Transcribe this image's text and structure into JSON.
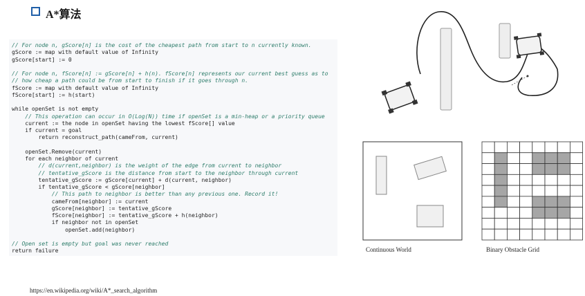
{
  "slide": {
    "title": "A*算法",
    "code_lines": [
      {
        "text": "// For node n, gScore[n] is the cost of the cheapest path from start to n currently known.",
        "type": "comment"
      },
      {
        "text": "gScore := map with default value of Infinity",
        "type": "code"
      },
      {
        "text": "gScore[start] := 0",
        "type": "code"
      },
      {
        "text": "",
        "type": "code"
      },
      {
        "text": "// For node n, fScore[n] := gScore[n] + h(n). fScore[n] represents our current best guess as to",
        "type": "comment"
      },
      {
        "text": "// how cheap a path could be from start to finish if it goes through n.",
        "type": "comment"
      },
      {
        "text": "fScore := map with default value of Infinity",
        "type": "code"
      },
      {
        "text": "fScore[start] := h(start)",
        "type": "code"
      },
      {
        "text": "",
        "type": "code"
      },
      {
        "text": "while openSet is not empty",
        "type": "code"
      },
      {
        "text": "    // This operation can occur in O(Log(N)) time if openSet is a min-heap or a priority queue",
        "type": "comment"
      },
      {
        "text": "    current := the node in openSet having the lowest fScore[] value",
        "type": "code"
      },
      {
        "text": "    if current = goal",
        "type": "code"
      },
      {
        "text": "        return reconstruct_path(cameFrom, current)",
        "type": "code"
      },
      {
        "text": "",
        "type": "code"
      },
      {
        "text": "    openSet.Remove(current)",
        "type": "code"
      },
      {
        "text": "    for each neighbor of current",
        "type": "code"
      },
      {
        "text": "        // d(current,neighbor) is the weight of the edge from current to neighbor",
        "type": "comment"
      },
      {
        "text": "        // tentative_gScore is the distance from start to the neighbor through current",
        "type": "comment"
      },
      {
        "text": "        tentative_gScore := gScore[current] + d(current, neighbor)",
        "type": "code"
      },
      {
        "text": "        if tentative_gScore < gScore[neighbor]",
        "type": "code"
      },
      {
        "text": "            // This path to neighbor is better than any previous one. Record it!",
        "type": "comment"
      },
      {
        "text": "            cameFrom[neighbor] := current",
        "type": "code"
      },
      {
        "text": "            gScore[neighbor] := tentative_gScore",
        "type": "code"
      },
      {
        "text": "            fScore[neighbor] := tentative_gScore + h(neighbor)",
        "type": "code"
      },
      {
        "text": "            if neighbor not in openSet",
        "type": "code"
      },
      {
        "text": "                openSet.add(neighbor)",
        "type": "code"
      },
      {
        "text": "",
        "type": "code"
      },
      {
        "text": "// Open set is empty but goal was never reached",
        "type": "comment"
      },
      {
        "text": "return failure",
        "type": "code"
      }
    ],
    "url": "https://en.wikipedia.org/wiki/A*_search_algorithm",
    "captions": {
      "continuous": "Continuous World",
      "binary": "Binary Obstacle Grid"
    },
    "grid": {
      "rows": 9,
      "cols": 8,
      "obstacles": [
        [
          1,
          1
        ],
        [
          2,
          1
        ],
        [
          3,
          1
        ],
        [
          4,
          1
        ],
        [
          5,
          1
        ],
        [
          1,
          4
        ],
        [
          1,
          5
        ],
        [
          1,
          6
        ],
        [
          2,
          4
        ],
        [
          2,
          5
        ],
        [
          2,
          6
        ],
        [
          5,
          4
        ],
        [
          5,
          5
        ],
        [
          5,
          6
        ],
        [
          6,
          4
        ],
        [
          6,
          5
        ],
        [
          6,
          6
        ]
      ]
    },
    "colors": {
      "accent": "#1f5fa8",
      "comment": "#2e7d6b",
      "code_bg": "#f7f8fa",
      "obstacle": "#a6a6a6"
    }
  }
}
